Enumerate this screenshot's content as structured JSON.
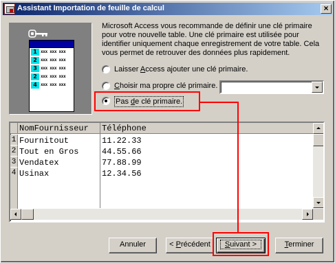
{
  "window": {
    "title": "Assistant Importation de feuille de calcul",
    "close_glyph": "×"
  },
  "illustration": {
    "row_numbers": [
      "1",
      "2",
      "3",
      "2",
      "4"
    ],
    "row_filler": "xxx xxx xxx"
  },
  "description": "Microsoft Access vous recommande de définir une clé primaire pour votre nouvelle table. Une clé primaire est utilisée pour identifier uniquement chaque enregistrement de votre table. Cela vous permet de retrouver des données plus rapidement.",
  "options": [
    {
      "before": "Laisser ",
      "accel": "A",
      "after": "ccess ajouter une clé primaire.",
      "checked": false
    },
    {
      "before": "",
      "accel": "C",
      "after": "hoisir ma propre clé primaire.",
      "checked": false
    },
    {
      "before": "Pas ",
      "accel": "d",
      "after": "e clé primaire.",
      "checked": true
    }
  ],
  "combo": {
    "value": ""
  },
  "grid": {
    "headers": [
      "NomFournisseur",
      "Téléphone"
    ],
    "rows": [
      {
        "num": "1",
        "name": "Fournitout",
        "phone": "11.22.33"
      },
      {
        "num": "2",
        "name": "Tout en Gros",
        "phone": "44.55.66"
      },
      {
        "num": "3",
        "name": "Vendatex",
        "phone": "77.88.99"
      },
      {
        "num": "4",
        "name": "Usinax",
        "phone": "12.34.56"
      }
    ]
  },
  "buttons": {
    "cancel": "Annuler",
    "prev_before": "< ",
    "prev_accel": "P",
    "prev_after": "récédent",
    "next_accel": "S",
    "next_after": "uivant >",
    "finish_accel": "T",
    "finish_after": "erminer"
  },
  "colors": {
    "annotation": "#ff0000",
    "titlebar_start": "#0a246a",
    "titlebar_end": "#a6caf0",
    "key_cells": "#00e0e8"
  }
}
